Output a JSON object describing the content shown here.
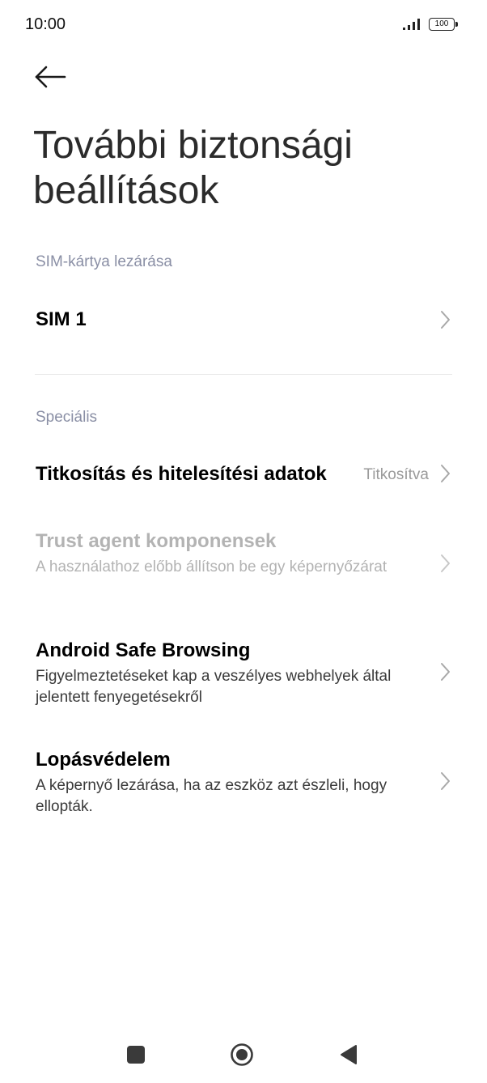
{
  "status_bar": {
    "time": "10:00",
    "battery": "100",
    "icons": [
      "signal-icon",
      "battery-icon"
    ]
  },
  "header": {
    "back_icon": "arrow-left-icon",
    "title": "További biztonsági beállítások"
  },
  "sections": [
    {
      "header": "SIM-kártya lezárása",
      "items": [
        {
          "title": "SIM 1"
        }
      ]
    },
    {
      "header": "Speciális",
      "items": [
        {
          "title": "Titkosítás és hitelesítési adatok",
          "value": "Titkosítva"
        },
        {
          "title": "Trust agent komponensek",
          "subtitle": "A használathoz előbb állítson be egy képernyőzárat",
          "disabled": true
        },
        {
          "title": "Android Safe Browsing",
          "subtitle": "Figyelmeztetéseket kap a veszélyes webhelyek által jelentett fenyegetésekről"
        },
        {
          "title": "Lopásvédelem",
          "subtitle": "A képernyő lezárása, ha az eszköz azt észleli, hogy ellopták."
        }
      ]
    }
  ],
  "navbar": {
    "icons": [
      "recents-icon",
      "home-icon",
      "back-triangle-icon"
    ]
  },
  "colors": {
    "section_header": "#8a8fa5",
    "disabled_text": "#b3b3b3",
    "value_text": "#9a9a9a",
    "chevron": "#a8a8a8"
  }
}
